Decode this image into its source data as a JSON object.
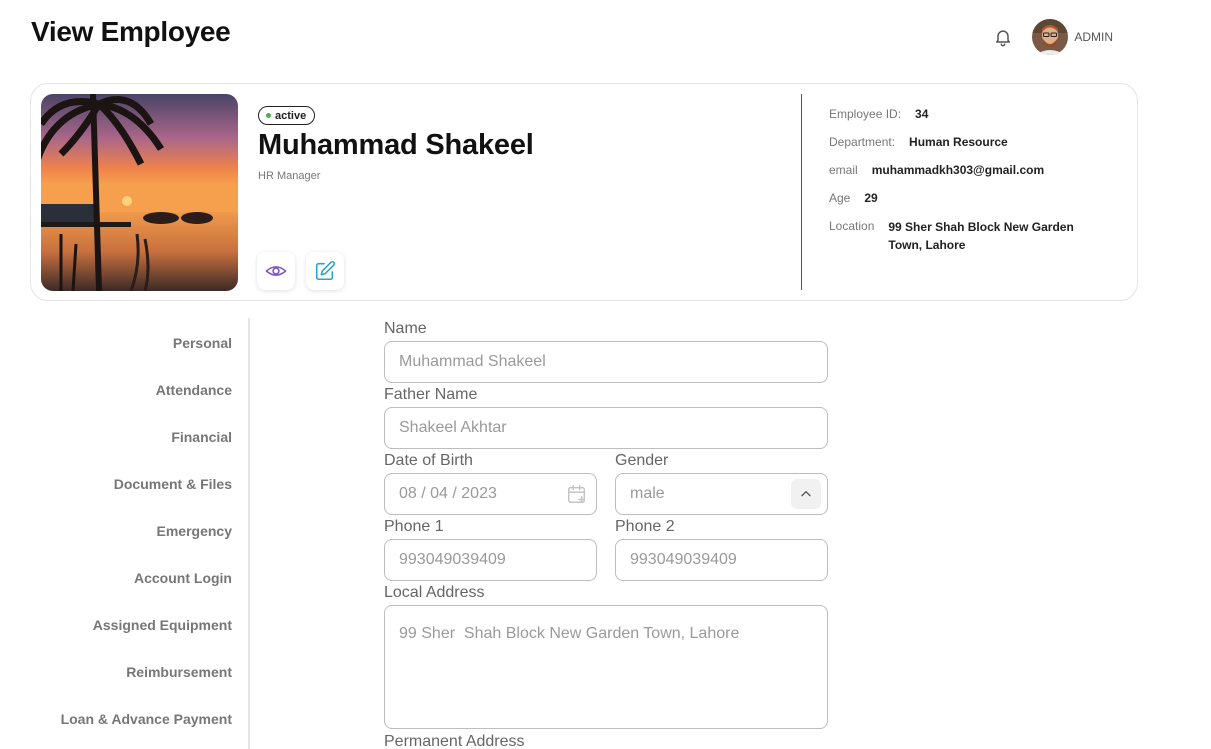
{
  "page": {
    "title": "View Employee"
  },
  "topbar": {
    "user_label": "ADMIN"
  },
  "profile": {
    "status": "active",
    "name": "Muhammad Shakeel",
    "role": "HR Manager",
    "info": {
      "employee_id_label": "Employee ID:",
      "employee_id": "34",
      "department_label": "Department:",
      "department": "Human Resource",
      "email_label": "email",
      "email": "muhammadkh303@gmail.com",
      "age_label": "Age",
      "age": "29",
      "location_label": "Location",
      "location": "99 Sher Shah Block New Garden Town, Lahore"
    }
  },
  "sidebar": {
    "items": [
      {
        "label": "Personal"
      },
      {
        "label": "Attendance"
      },
      {
        "label": "Financial"
      },
      {
        "label": "Document & Files"
      },
      {
        "label": "Emergency"
      },
      {
        "label": "Account Login"
      },
      {
        "label": "Assigned Equipment"
      },
      {
        "label": "Reimbursement"
      },
      {
        "label": "Loan & Advance Payment"
      }
    ]
  },
  "form": {
    "name_label": "Name",
    "name_value": "Muhammad Shakeel",
    "father_label": "Father Name",
    "father_value": "Shakeel Akhtar",
    "dob_label": "Date of Birth",
    "dob_value": "08 / 04 / 2023",
    "gender_label": "Gender",
    "gender_value": "male",
    "phone1_label": "Phone 1",
    "phone1_value": "993049039409",
    "phone2_label": "Phone 2",
    "phone2_value": "993049039409",
    "local_address_label": "Local Address",
    "local_address_value": "99 Sher  Shah Block New Garden Town, Lahore",
    "permanent_address_label": "Permanent Address"
  },
  "colors": {
    "status_dot": "#4caf50",
    "view_icon": "#7e57c2",
    "edit_icon": "#26a6c9"
  },
  "icons": {
    "notification": "bell-icon",
    "view": "eye-icon",
    "edit": "edit-icon",
    "calendar": "calendar-icon",
    "dropdown": "chevron-up-icon"
  }
}
